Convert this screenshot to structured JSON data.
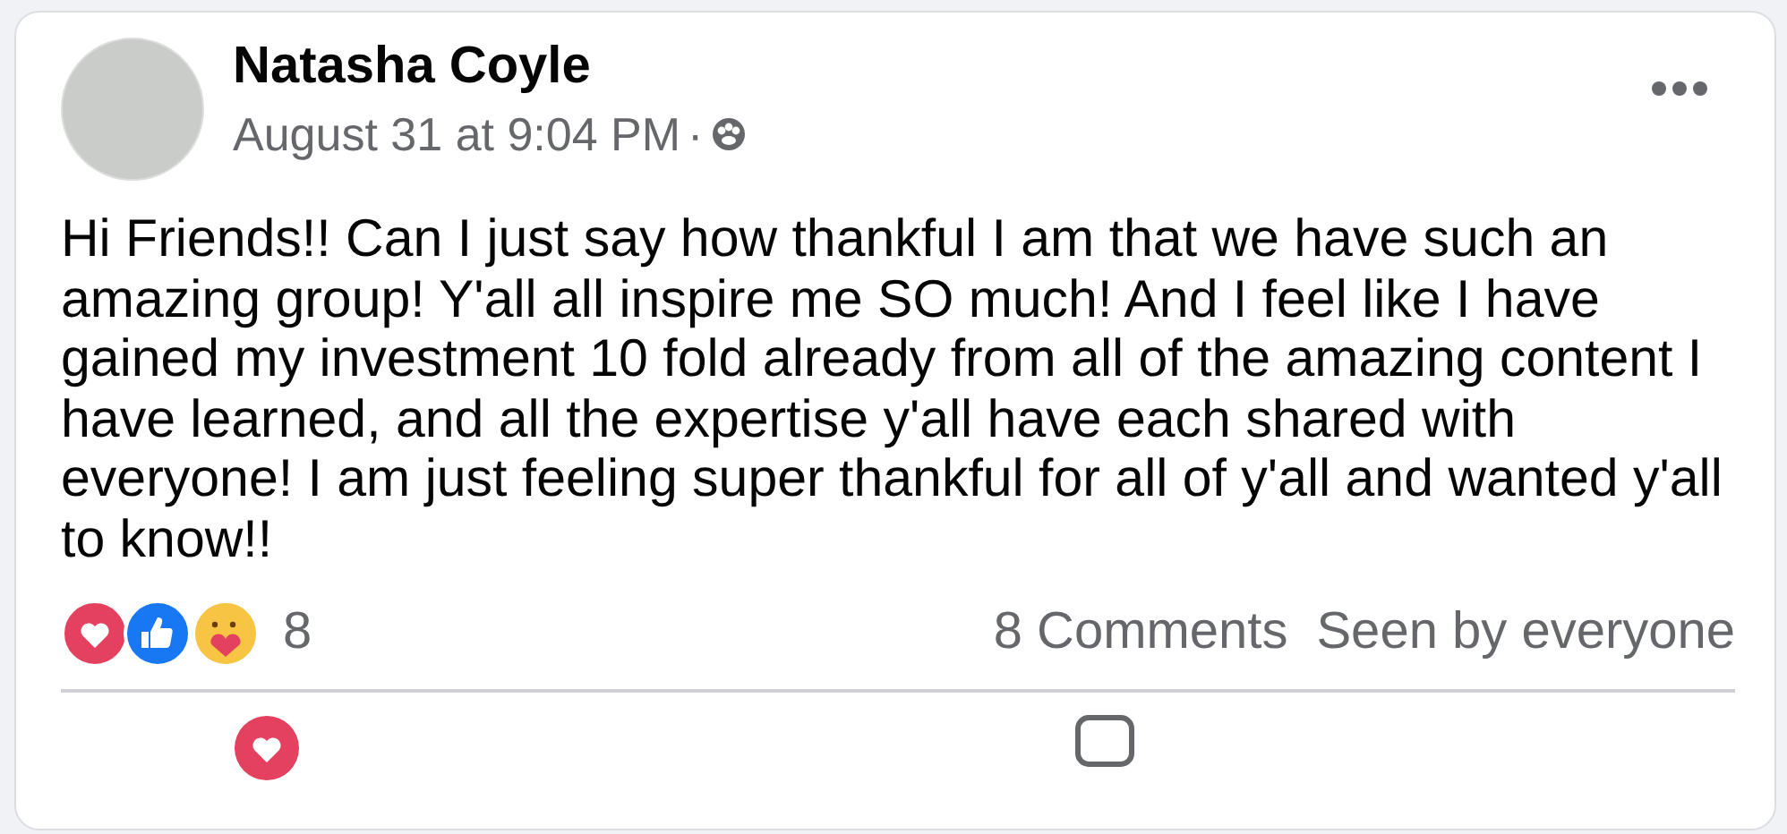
{
  "post": {
    "author": "Natasha Coyle",
    "timestamp": "August 31 at 9:04 PM",
    "separator": "·",
    "body": "Hi Friends!! Can I just say how thankful I am that we have such an amazing group! Y'all all inspire me SO much! And I feel like I have gained my investment 10 fold already from all of the amazing content I have learned, and all the expertise y'all have each shared with everyone! I am just feeling super thankful for all of y'all and wanted y'all to know!!",
    "reaction_count": "8",
    "comments": "8 Comments",
    "audience": "Seen by everyone"
  }
}
